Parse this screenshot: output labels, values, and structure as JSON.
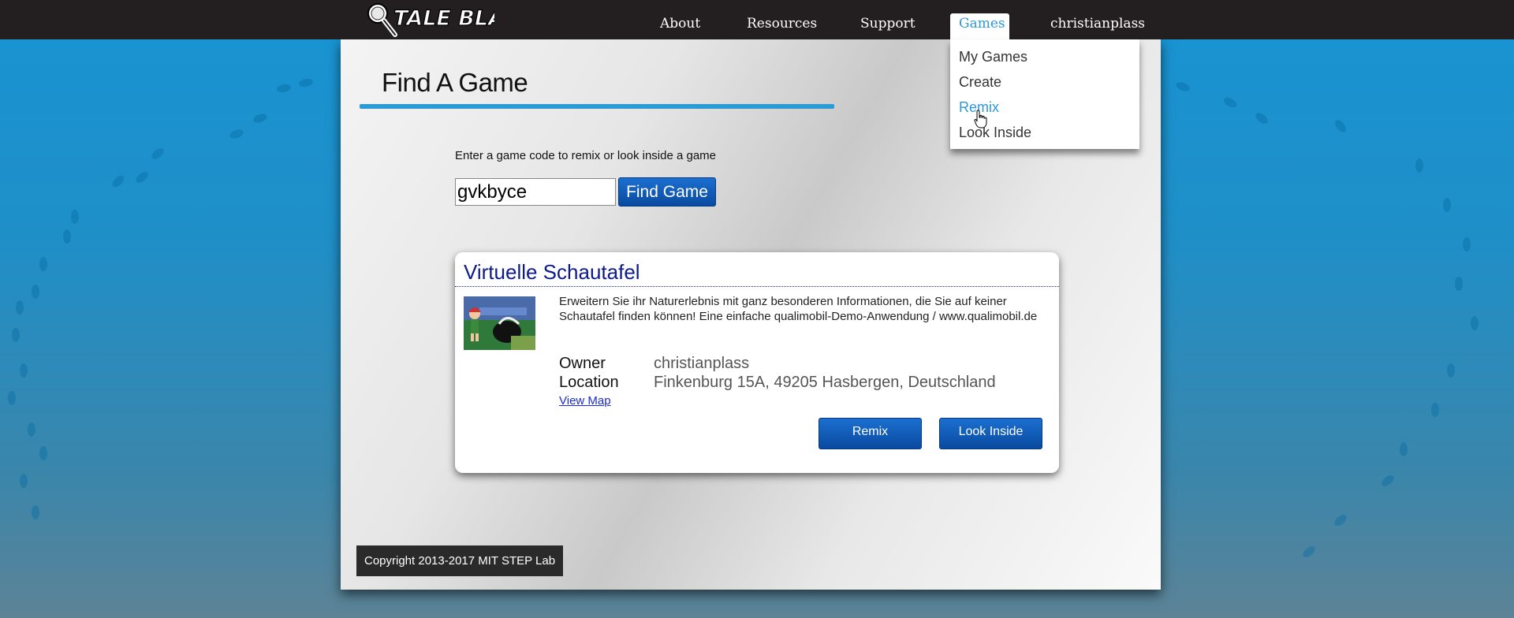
{
  "header": {
    "logo_text": "TALE BLAZER",
    "nav": [
      {
        "label": "About"
      },
      {
        "label": "Resources"
      },
      {
        "label": "Support"
      },
      {
        "label": "Games"
      },
      {
        "label": "christianplass"
      }
    ],
    "games_menu": [
      {
        "label": "My Games"
      },
      {
        "label": "Create"
      },
      {
        "label": "Remix"
      },
      {
        "label": "Look Inside"
      }
    ]
  },
  "page": {
    "title": "Find A Game",
    "prompt": "Enter a game code to remix or look inside a game",
    "code_value": "gvkbyce",
    "find_label": "Find Game"
  },
  "game": {
    "title": "Virtuelle Schautafel",
    "description": "Erweitern Sie ihr Naturerlebnis mit ganz besonderen Informationen, die Sie auf keiner Schautafel finden können! Eine einfache qualimobil-Demo-Anwendung / www.qualimobil.de",
    "owner_label": "Owner",
    "owner_value": "christianplass",
    "location_label": "Location",
    "location_value": "Finkenburg 15A, 49205 Hasbergen, Deutschland",
    "view_map": "View Map",
    "remix_label": "Remix",
    "look_inside_label": "Look Inside"
  },
  "footer": {
    "copyright": "Copyright 2013-2017 MIT STEP Lab"
  },
  "colors": {
    "accent": "#2b9ad6",
    "topbar": "#231f20",
    "button": "#0a4aa0",
    "card_title": "#0d1a8a"
  }
}
